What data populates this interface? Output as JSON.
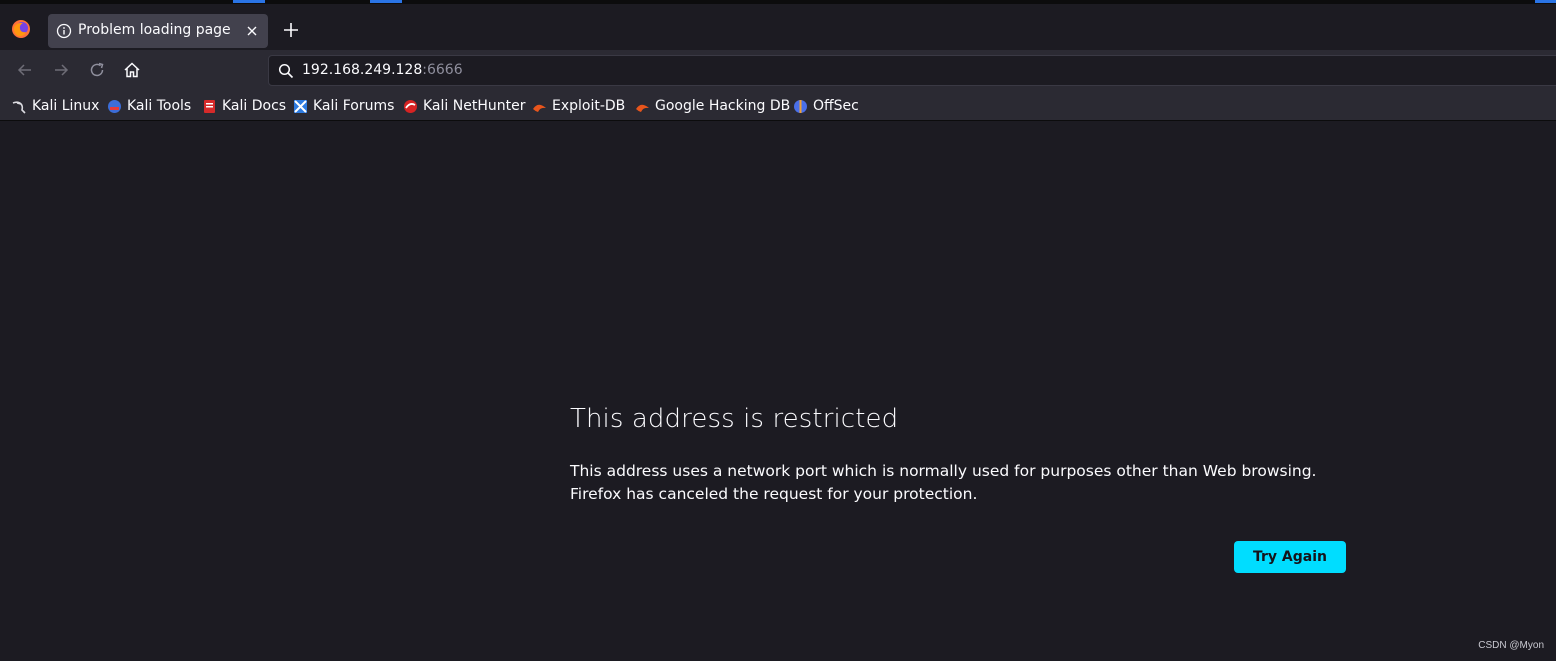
{
  "tab": {
    "title": "Problem loading page"
  },
  "address_bar": {
    "host": "192.168.249.128",
    "port": ":6666"
  },
  "bookmarks": [
    {
      "label": "Kali Linux",
      "icon": "kali-dragon-icon"
    },
    {
      "label": "Kali Tools",
      "icon": "kali-tools-icon"
    },
    {
      "label": "Kali Docs",
      "icon": "kali-docs-icon"
    },
    {
      "label": "Kali Forums",
      "icon": "kali-forums-icon"
    },
    {
      "label": "Kali NetHunter",
      "icon": "nethunter-icon"
    },
    {
      "label": "Exploit-DB",
      "icon": "exploit-db-icon"
    },
    {
      "label": "Google Hacking DB",
      "icon": "ghdb-icon"
    },
    {
      "label": "OffSec",
      "icon": "offsec-icon"
    }
  ],
  "error": {
    "title": "This address is restricted",
    "line1": "This address uses a network port which is normally used for purposes other than Web browsing.",
    "line2": "Firefox has canceled the request for your protection.",
    "button": "Try Again"
  },
  "watermark": "CSDN @Myon⁠",
  "colors": {
    "page_bg": "#1c1b22",
    "toolbar_bg": "#2b2a33",
    "accent": "#00ddff"
  }
}
